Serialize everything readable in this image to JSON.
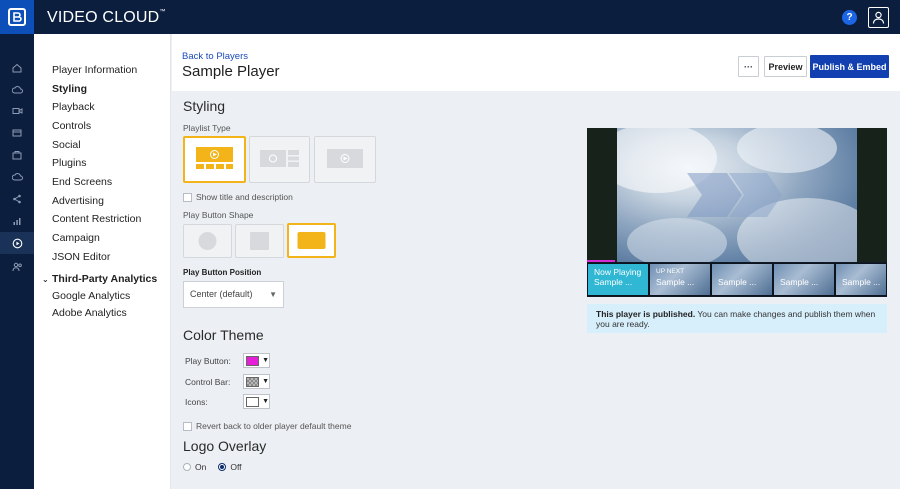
{
  "app": {
    "brand": "VIDEO CLOUD",
    "trademark": "™"
  },
  "topbar": {
    "help_label": "?"
  },
  "sidenav": {
    "items": [
      {
        "label": "Player Information",
        "bold": false
      },
      {
        "label": "Styling",
        "bold": true
      },
      {
        "label": "Playback",
        "bold": false
      },
      {
        "label": "Controls",
        "bold": false
      },
      {
        "label": "Social",
        "bold": false
      },
      {
        "label": "Plugins",
        "bold": false
      },
      {
        "label": "End Screens",
        "bold": false
      },
      {
        "label": "Advertising",
        "bold": false
      },
      {
        "label": "Content Restriction",
        "bold": false
      },
      {
        "label": "Campaign",
        "bold": false
      },
      {
        "label": "JSON Editor",
        "bold": false
      }
    ],
    "group": {
      "label": "Third-Party Analytics",
      "children": [
        "Google Analytics",
        "Adobe Analytics"
      ]
    }
  },
  "header": {
    "back_link": "Back to Players",
    "title": "Sample Player",
    "more_label": "···",
    "preview_label": "Preview",
    "publish_label": "Publish & Embed"
  },
  "styling": {
    "heading": "Styling",
    "playlist_type_label": "Playlist Type",
    "show_title_label": "Show title and description",
    "play_button_shape_label": "Play Button Shape",
    "play_button_position_label": "Play Button Position",
    "play_button_position_value": "Center (default)"
  },
  "color_theme": {
    "heading": "Color Theme",
    "play_button_label": "Play Button:",
    "control_bar_label": "Control Bar:",
    "icons_label": "Icons:",
    "colors": {
      "play_button": "#e51fd8",
      "control_bar": "#9a9a9a",
      "icons": "#ffffff"
    },
    "revert_label": "Revert back to older player default theme"
  },
  "logo_overlay": {
    "heading": "Logo Overlay",
    "on_label": "On",
    "off_label": "Off",
    "selected": "Off"
  },
  "preview": {
    "thumbs": [
      {
        "top": "Now Playing",
        "title": "Sample ..."
      },
      {
        "top": "UP NEXT",
        "title": "Sample ..."
      },
      {
        "top": "",
        "title": "Sample ..."
      },
      {
        "top": "",
        "title": "Sample ..."
      },
      {
        "top": "",
        "title": "Sample ..."
      }
    ],
    "notice_bold": "This player is published.",
    "notice_rest": " You can make changes and publish them when you are ready."
  },
  "accent_colors": {
    "topbar": "#0c1e3e",
    "primary": "#1240b0",
    "selected_tile": "#f2b418"
  }
}
